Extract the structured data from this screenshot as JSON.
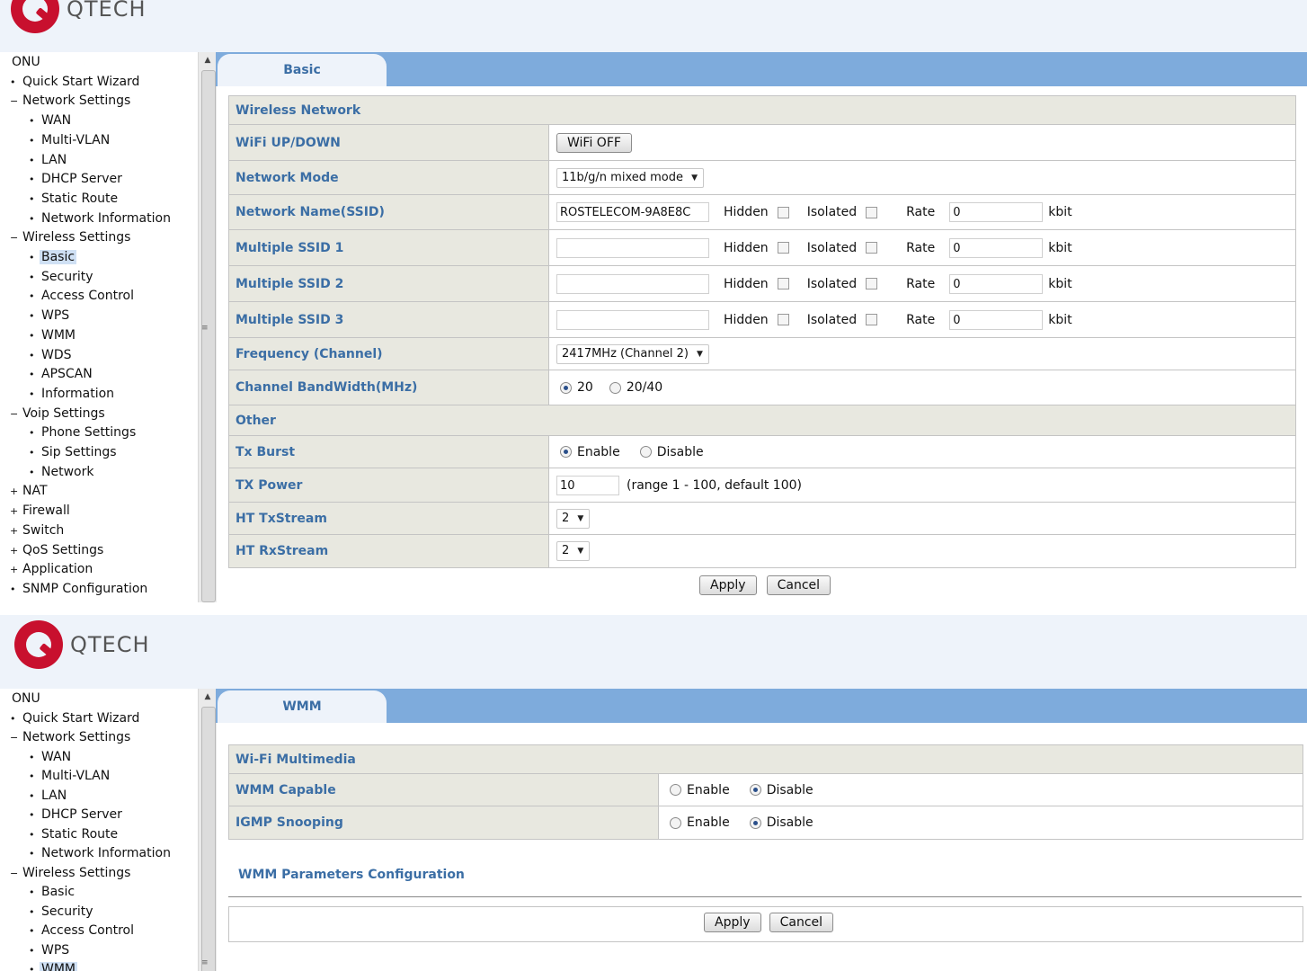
{
  "brand": {
    "name": "QTECH"
  },
  "panel1": {
    "sidebar": {
      "items": [
        {
          "bullet": "",
          "label": "ONU"
        },
        {
          "bullet": "•",
          "label": "Quick Start Wizard"
        },
        {
          "bullet": "−",
          "label": "Network Settings"
        },
        {
          "bullet": "•",
          "label": "WAN"
        },
        {
          "bullet": "•",
          "label": "Multi-VLAN"
        },
        {
          "bullet": "•",
          "label": "LAN"
        },
        {
          "bullet": "•",
          "label": "DHCP Server"
        },
        {
          "bullet": "•",
          "label": "Static Route"
        },
        {
          "bullet": "•",
          "label": "Network Information"
        },
        {
          "bullet": "−",
          "label": "Wireless Settings"
        },
        {
          "bullet": "•",
          "label": "Basic"
        },
        {
          "bullet": "•",
          "label": "Security"
        },
        {
          "bullet": "•",
          "label": "Access Control"
        },
        {
          "bullet": "•",
          "label": "WPS"
        },
        {
          "bullet": "•",
          "label": "WMM"
        },
        {
          "bullet": "•",
          "label": "WDS"
        },
        {
          "bullet": "•",
          "label": "APSCAN"
        },
        {
          "bullet": "•",
          "label": "Information"
        },
        {
          "bullet": "−",
          "label": "Voip Settings"
        },
        {
          "bullet": "•",
          "label": "Phone Settings"
        },
        {
          "bullet": "•",
          "label": "Sip Settings"
        },
        {
          "bullet": "•",
          "label": "Network"
        },
        {
          "bullet": "+",
          "label": "NAT"
        },
        {
          "bullet": "+",
          "label": "Firewall"
        },
        {
          "bullet": "+",
          "label": "Switch"
        },
        {
          "bullet": "+",
          "label": "QoS Settings"
        },
        {
          "bullet": "+",
          "label": "Application"
        },
        {
          "bullet": "•",
          "label": "SNMP Configuration"
        }
      ]
    },
    "tab": "Basic",
    "wireless_section": "Wireless Network",
    "wifi_label": "WiFi UP/DOWN",
    "wifi_button": "WiFi OFF",
    "mode_label": "Network Mode",
    "mode_value": "11b/g/n mixed mode",
    "ssids": [
      {
        "label": "Network Name(SSID)",
        "value": "ROSTELECOM-9A8E8C",
        "rate": "0"
      },
      {
        "label": "Multiple SSID 1",
        "value": "",
        "rate": "0"
      },
      {
        "label": "Multiple SSID 2",
        "value": "",
        "rate": "0"
      },
      {
        "label": "Multiple SSID 3",
        "value": "",
        "rate": "0"
      }
    ],
    "hidden_label": "Hidden",
    "isolated_label": "Isolated",
    "rate_label": "Rate",
    "rate_unit": "kbit",
    "freq_label": "Frequency (Channel)",
    "freq_value": "2417MHz (Channel 2)",
    "bw_label": "Channel BandWidth(MHz)",
    "bw_opt1": "20",
    "bw_opt2": "20/40",
    "other_section": "Other",
    "txburst_label": "Tx Burst",
    "enable": "Enable",
    "disable": "Disable",
    "txpower_label": "TX Power",
    "txpower_value": "10",
    "txpower_hint": "(range 1 - 100, default 100)",
    "httx_label": "HT TxStream",
    "httx_value": "2",
    "htrx_label": "HT RxStream",
    "htrx_value": "2",
    "apply": "Apply",
    "cancel": "Cancel"
  },
  "panel2": {
    "sidebar": {
      "items": [
        {
          "bullet": "",
          "label": "ONU"
        },
        {
          "bullet": "•",
          "label": "Quick Start Wizard"
        },
        {
          "bullet": "−",
          "label": "Network Settings"
        },
        {
          "bullet": "•",
          "label": "WAN"
        },
        {
          "bullet": "•",
          "label": "Multi-VLAN"
        },
        {
          "bullet": "•",
          "label": "LAN"
        },
        {
          "bullet": "•",
          "label": "DHCP Server"
        },
        {
          "bullet": "•",
          "label": "Static Route"
        },
        {
          "bullet": "•",
          "label": "Network Information"
        },
        {
          "bullet": "−",
          "label": "Wireless Settings"
        },
        {
          "bullet": "•",
          "label": "Basic"
        },
        {
          "bullet": "•",
          "label": "Security"
        },
        {
          "bullet": "•",
          "label": "Access Control"
        },
        {
          "bullet": "•",
          "label": "WPS"
        },
        {
          "bullet": "•",
          "label": "WMM"
        }
      ]
    },
    "tab": "WMM",
    "section": "Wi-Fi Multimedia",
    "wmm_label": "WMM Capable",
    "igmp_label": "IGMP Snooping",
    "enable": "Enable",
    "disable": "Disable",
    "params_title": "WMM Parameters Configuration",
    "apply": "Apply",
    "cancel": "Cancel"
  }
}
